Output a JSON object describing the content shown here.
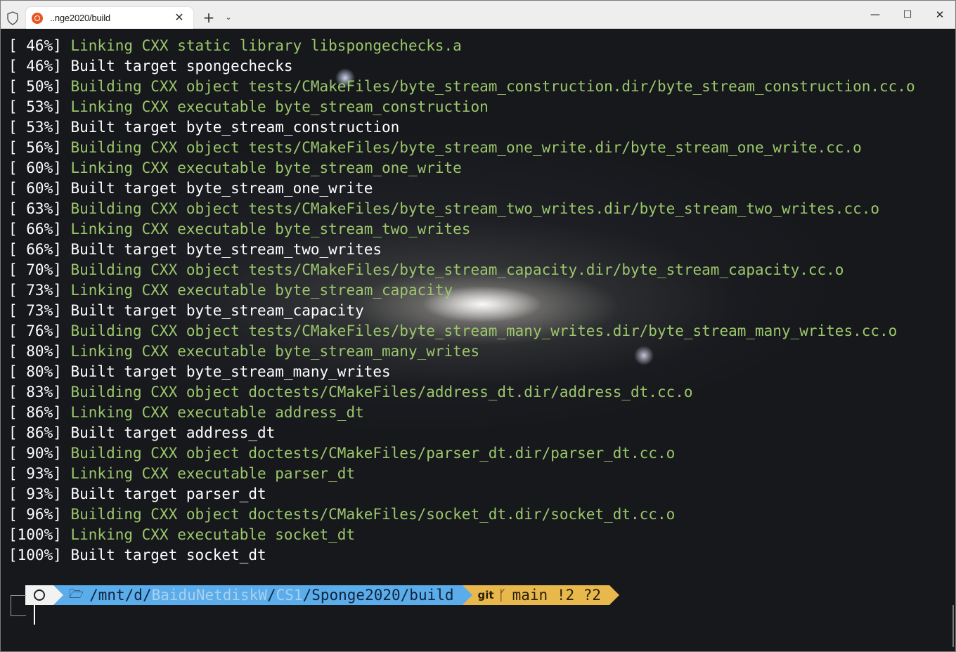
{
  "window": {
    "tab_title": "..nge2020/build",
    "close_glyph": "✕",
    "new_tab_glyph": "+",
    "dropdown_glyph": "⌄",
    "minimize_glyph": "—",
    "maximize_glyph": "☐",
    "window_close_glyph": "✕"
  },
  "terminal": {
    "lines": [
      {
        "pct": "[ 46%]",
        "text": " Linking CXX static library libspongechecks.a",
        "color": "green"
      },
      {
        "pct": "[ 46%]",
        "text": " Built target spongechecks",
        "color": "white"
      },
      {
        "pct": "[ 50%]",
        "text": " Building CXX object tests/CMakeFiles/byte_stream_construction.dir/byte_stream_construction.cc.o",
        "color": "green"
      },
      {
        "pct": "[ 53%]",
        "text": " Linking CXX executable byte_stream_construction",
        "color": "green"
      },
      {
        "pct": "[ 53%]",
        "text": " Built target byte_stream_construction",
        "color": "white"
      },
      {
        "pct": "[ 56%]",
        "text": " Building CXX object tests/CMakeFiles/byte_stream_one_write.dir/byte_stream_one_write.cc.o",
        "color": "green"
      },
      {
        "pct": "[ 60%]",
        "text": " Linking CXX executable byte_stream_one_write",
        "color": "green"
      },
      {
        "pct": "[ 60%]",
        "text": " Built target byte_stream_one_write",
        "color": "white"
      },
      {
        "pct": "[ 63%]",
        "text": " Building CXX object tests/CMakeFiles/byte_stream_two_writes.dir/byte_stream_two_writes.cc.o",
        "color": "green"
      },
      {
        "pct": "[ 66%]",
        "text": " Linking CXX executable byte_stream_two_writes",
        "color": "green"
      },
      {
        "pct": "[ 66%]",
        "text": " Built target byte_stream_two_writes",
        "color": "white"
      },
      {
        "pct": "[ 70%]",
        "text": " Building CXX object tests/CMakeFiles/byte_stream_capacity.dir/byte_stream_capacity.cc.o",
        "color": "green"
      },
      {
        "pct": "[ 73%]",
        "text": " Linking CXX executable byte_stream_capacity",
        "color": "green"
      },
      {
        "pct": "[ 73%]",
        "text": " Built target byte_stream_capacity",
        "color": "white"
      },
      {
        "pct": "[ 76%]",
        "text": " Building CXX object tests/CMakeFiles/byte_stream_many_writes.dir/byte_stream_many_writes.cc.o",
        "color": "green"
      },
      {
        "pct": "[ 80%]",
        "text": " Linking CXX executable byte_stream_many_writes",
        "color": "green"
      },
      {
        "pct": "[ 80%]",
        "text": " Built target byte_stream_many_writes",
        "color": "white"
      },
      {
        "pct": "[ 83%]",
        "text": " Building CXX object doctests/CMakeFiles/address_dt.dir/address_dt.cc.o",
        "color": "green"
      },
      {
        "pct": "[ 86%]",
        "text": " Linking CXX executable address_dt",
        "color": "green"
      },
      {
        "pct": "[ 86%]",
        "text": " Built target address_dt",
        "color": "white"
      },
      {
        "pct": "[ 90%]",
        "text": " Building CXX object doctests/CMakeFiles/parser_dt.dir/parser_dt.cc.o",
        "color": "green"
      },
      {
        "pct": "[ 93%]",
        "text": " Linking CXX executable parser_dt",
        "color": "green"
      },
      {
        "pct": "[ 93%]",
        "text": " Built target parser_dt",
        "color": "white"
      },
      {
        "pct": "[ 96%]",
        "text": " Building CXX object doctests/CMakeFiles/socket_dt.dir/socket_dt.cc.o",
        "color": "green"
      },
      {
        "pct": "[100%]",
        "text": " Linking CXX executable socket_dt",
        "color": "green"
      },
      {
        "pct": "[100%]",
        "text": " Built target socket_dt",
        "color": "white"
      }
    ]
  },
  "prompt": {
    "folder_glyph": "🗁",
    "path_parts": [
      {
        "text": "/mnt/d/",
        "dim": false
      },
      {
        "text": "BaiduNetdiskW",
        "dim": true
      },
      {
        "text": "/",
        "dim": false
      },
      {
        "text": "CS1",
        "dim": true
      },
      {
        "text": "/Sponge2020/build",
        "dim": false
      }
    ],
    "git_label": "git",
    "branch_glyph": "ᚴ",
    "branch": "main",
    "status": "!2 ?2"
  },
  "colors": {
    "green_text": "#9cc76b",
    "path_segment": "#5aacea",
    "git_segment": "#e9b84d",
    "os_segment": "#f2f2f2",
    "ubuntu_orange": "#e95420"
  }
}
